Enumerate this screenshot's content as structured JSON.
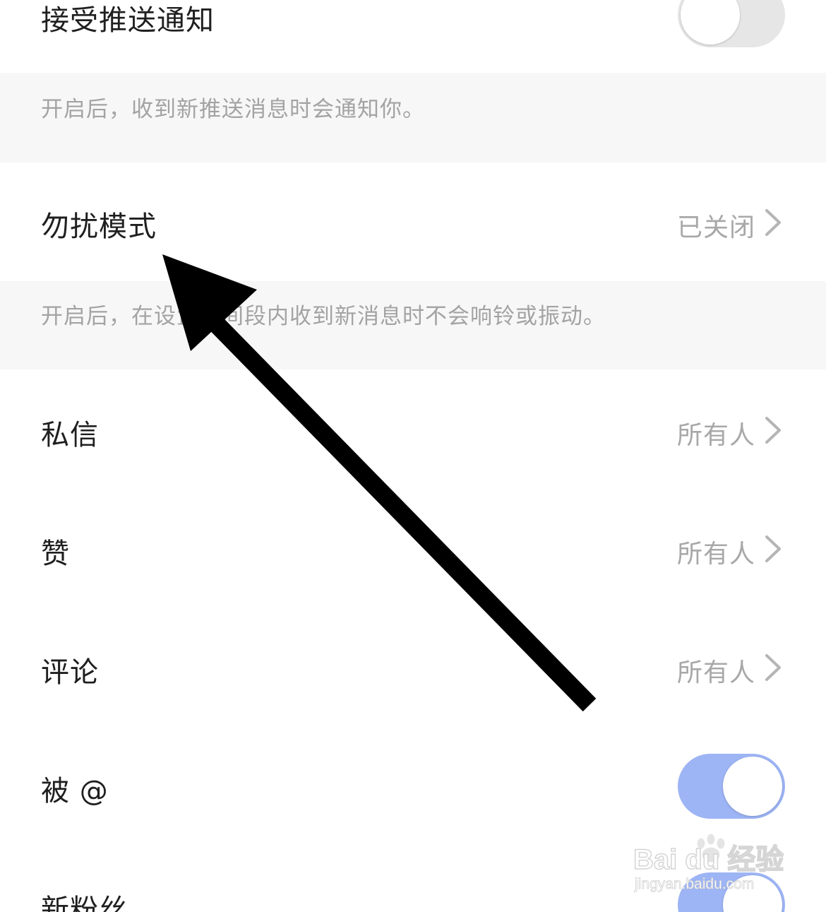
{
  "settings": {
    "push": {
      "label": "接受推送通知",
      "enabled": false,
      "description": "开启后，收到新推送消息时会通知你。"
    },
    "dnd": {
      "label": "勿扰模式",
      "value": "已关闭",
      "description": "开启后，在设置时间段内收到新消息时不会响铃或振动。"
    },
    "dm": {
      "label": "私信",
      "value": "所有人"
    },
    "likes": {
      "label": "赞",
      "value": "所有人"
    },
    "comments": {
      "label": "评论",
      "value": "所有人"
    },
    "mentions": {
      "label": "被 @",
      "enabled": true
    },
    "followers": {
      "label": "新粉丝",
      "enabled": true
    }
  },
  "watermark": {
    "text_main": "Bai du 经验",
    "text_sub": "jingyan.baidu.com"
  },
  "colors": {
    "toggle_on": "#9db4f5",
    "toggle_off": "#e6e6e6",
    "description_bg": "#f7f7f7",
    "secondary_text": "#a8a8a8",
    "arrow": "#000000"
  },
  "icons": {
    "chevron": "chevron-right-icon",
    "annotation": "arrow-annotation"
  }
}
